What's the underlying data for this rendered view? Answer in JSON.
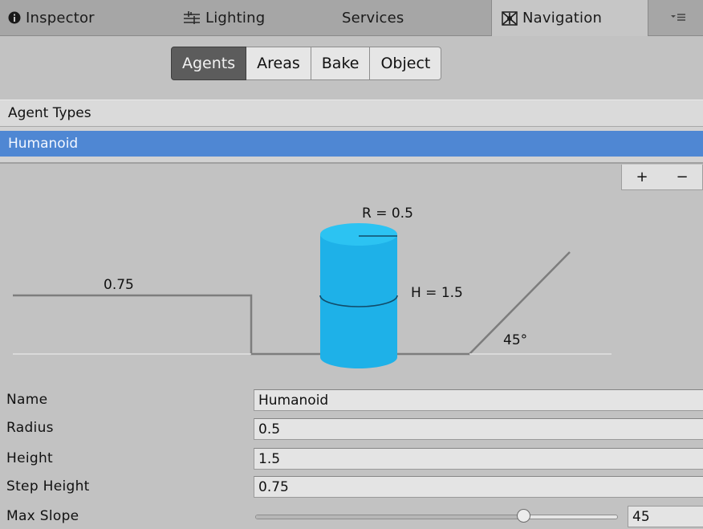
{
  "tabs": [
    {
      "label": "Inspector",
      "icon": "info-icon",
      "active": false
    },
    {
      "label": "Lighting",
      "icon": "lighting-icon",
      "active": false
    },
    {
      "label": "Services",
      "icon": "",
      "active": false
    },
    {
      "label": "Navigation",
      "icon": "navigation-icon",
      "active": true
    }
  ],
  "window_menu_icon": "dropdown-menu-icon",
  "segments": [
    {
      "label": "Agents",
      "active": true
    },
    {
      "label": "Areas",
      "active": false
    },
    {
      "label": "Bake",
      "active": false
    },
    {
      "label": "Object",
      "active": false
    }
  ],
  "agent_types": {
    "header": "Agent Types",
    "items": [
      {
        "label": "Humanoid",
        "selected": true
      }
    ],
    "add_label": "+",
    "remove_label": "−"
  },
  "diagram": {
    "step_label": "0.75",
    "radius_label": "R = 0.5",
    "height_label": "H = 1.5",
    "slope_label": "45°",
    "agent_color": "#1eb1e8"
  },
  "properties": [
    {
      "label": "Name",
      "value": "Humanoid"
    },
    {
      "label": "Radius",
      "value": "0.5"
    },
    {
      "label": "Height",
      "value": "1.5"
    },
    {
      "label": "Step Height",
      "value": "0.75"
    }
  ],
  "max_slope": {
    "label": "Max Slope",
    "value": "45",
    "min": 0,
    "max": 60
  },
  "colors": {
    "selection": "#4f87d3",
    "active_segment": "#5c5c5c",
    "panel_bg": "#c2c2c2"
  }
}
